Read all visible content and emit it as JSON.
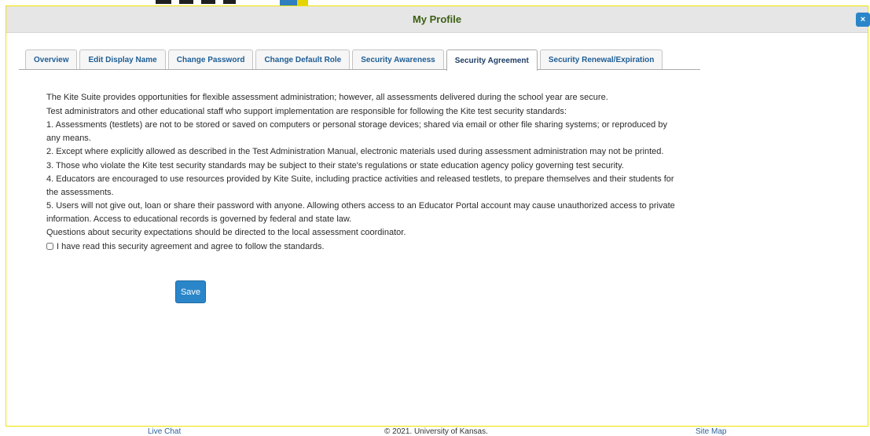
{
  "dialog": {
    "title": "My Profile",
    "close_label": "×"
  },
  "tabs": [
    {
      "label": "Overview"
    },
    {
      "label": "Edit Display Name"
    },
    {
      "label": "Change Password"
    },
    {
      "label": "Change Default Role"
    },
    {
      "label": "Security Awareness"
    },
    {
      "label": "Security Agreement",
      "active": true
    },
    {
      "label": "Security Renewal/Expiration"
    }
  ],
  "agreement": {
    "paragraphs": [
      "The Kite Suite provides opportunities for flexible assessment administration; however, all assessments delivered during the school year are secure.",
      "Test administrators and other educational staff who support implementation are responsible for following the Kite test security standards:",
      "1. Assessments (testlets) are not to be stored or saved on computers or personal storage devices; shared via email or other file sharing systems; or reproduced by any means.",
      "2. Except where explicitly allowed as described in the Test Administration Manual, electronic materials used during assessment administration may not be printed.",
      "3. Those who violate the Kite test security standards may be subject to their state's regulations or state education agency policy governing test security.",
      "4. Educators are encouraged to use resources provided by Kite Suite, including practice activities and released testlets, to prepare themselves and their students for the assessments.",
      "5. Users will not give out, loan or share their password with anyone. Allowing others access to an Educator Portal account may cause unauthorized access to private information. Access to educational records is governed by federal and state law.",
      "Questions about security expectations should be directed to the local assessment coordinator."
    ],
    "checkbox_label": "I have read this security agreement and agree to follow the standards.",
    "checkbox_checked": false,
    "save_label": "Save"
  },
  "footer": {
    "live_chat": "Live Chat",
    "copyright": "© 2021. University of Kansas.",
    "site_map": "Site Map"
  },
  "colors": {
    "accent": "#2a86c9",
    "title": "#3b5f12",
    "tab_text": "#1d5d94"
  }
}
